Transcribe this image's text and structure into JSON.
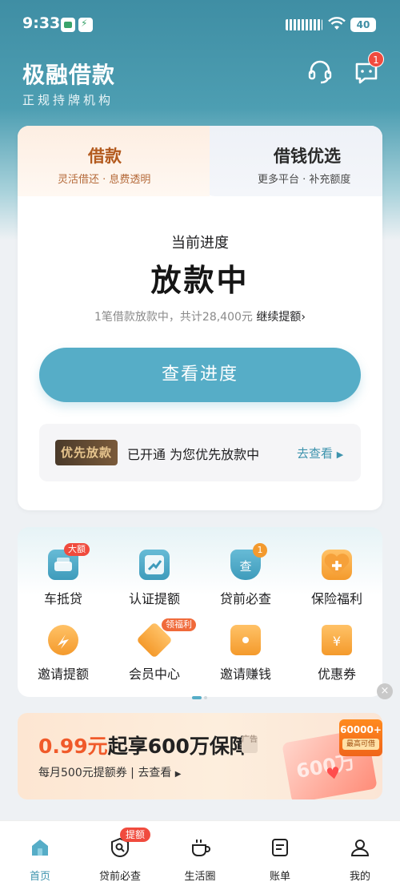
{
  "status_bar": {
    "time": "9:33",
    "battery": "40"
  },
  "header": {
    "title": "极融借款",
    "subtitle": "正规持牌机构",
    "message_badge": "1"
  },
  "loan_card": {
    "tab_loan": {
      "label": "借款",
      "sub": "灵活借还 · 息费透明"
    },
    "tab_alt": {
      "label": "借钱优选",
      "sub": "更多平台 · 补充额度"
    },
    "progress_label": "当前进度",
    "progress_status": "放款中",
    "progress_detail": "1笔借款放款中，共计28,400元",
    "continue_link": "继续提额",
    "view_button": "查看进度",
    "priority_tag": "优先放款",
    "priority_text": "已开通 为您优先放款中",
    "priority_link": "去查看"
  },
  "services": [
    {
      "label": "车抵贷",
      "icon": "car-icon",
      "badge": "大额"
    },
    {
      "label": "认证提额",
      "icon": "trend-up-icon",
      "badge": ""
    },
    {
      "label": "贷前必查",
      "icon": "check-shield-icon",
      "badge": "1"
    },
    {
      "label": "保险福利",
      "icon": "heart-plus-icon",
      "badge": ""
    },
    {
      "label": "邀请提额",
      "icon": "share-icon",
      "badge": ""
    },
    {
      "label": "会员中心",
      "icon": "crown-icon",
      "badge": "领福利"
    },
    {
      "label": "邀请赚钱",
      "icon": "envelope-icon",
      "badge": ""
    },
    {
      "label": "优惠券",
      "icon": "coupon-icon",
      "badge": ""
    }
  ],
  "promo": {
    "title_highlight": "0.99元",
    "title_rest": "起享600万保障",
    "small_tag": "广告",
    "sub": "每月500元提额券 | 去查看",
    "envelope_text": "600万",
    "amount": "60000+",
    "amount_sub": "最高可借"
  },
  "bottom_nav": {
    "items": [
      {
        "label": "首页",
        "icon": "home-icon"
      },
      {
        "label": "贷前必查",
        "icon": "shield-search-icon"
      },
      {
        "label": "生活圈",
        "icon": "coffee-icon"
      },
      {
        "label": "账单",
        "icon": "bill-icon"
      },
      {
        "label": "我的",
        "icon": "user-icon"
      }
    ],
    "badge": "提额"
  },
  "colors": {
    "accent": "#56adc7",
    "header_bg": "#3f8ea4",
    "badge_red": "#f04b3e",
    "promo_orange": "#f05a2a"
  }
}
